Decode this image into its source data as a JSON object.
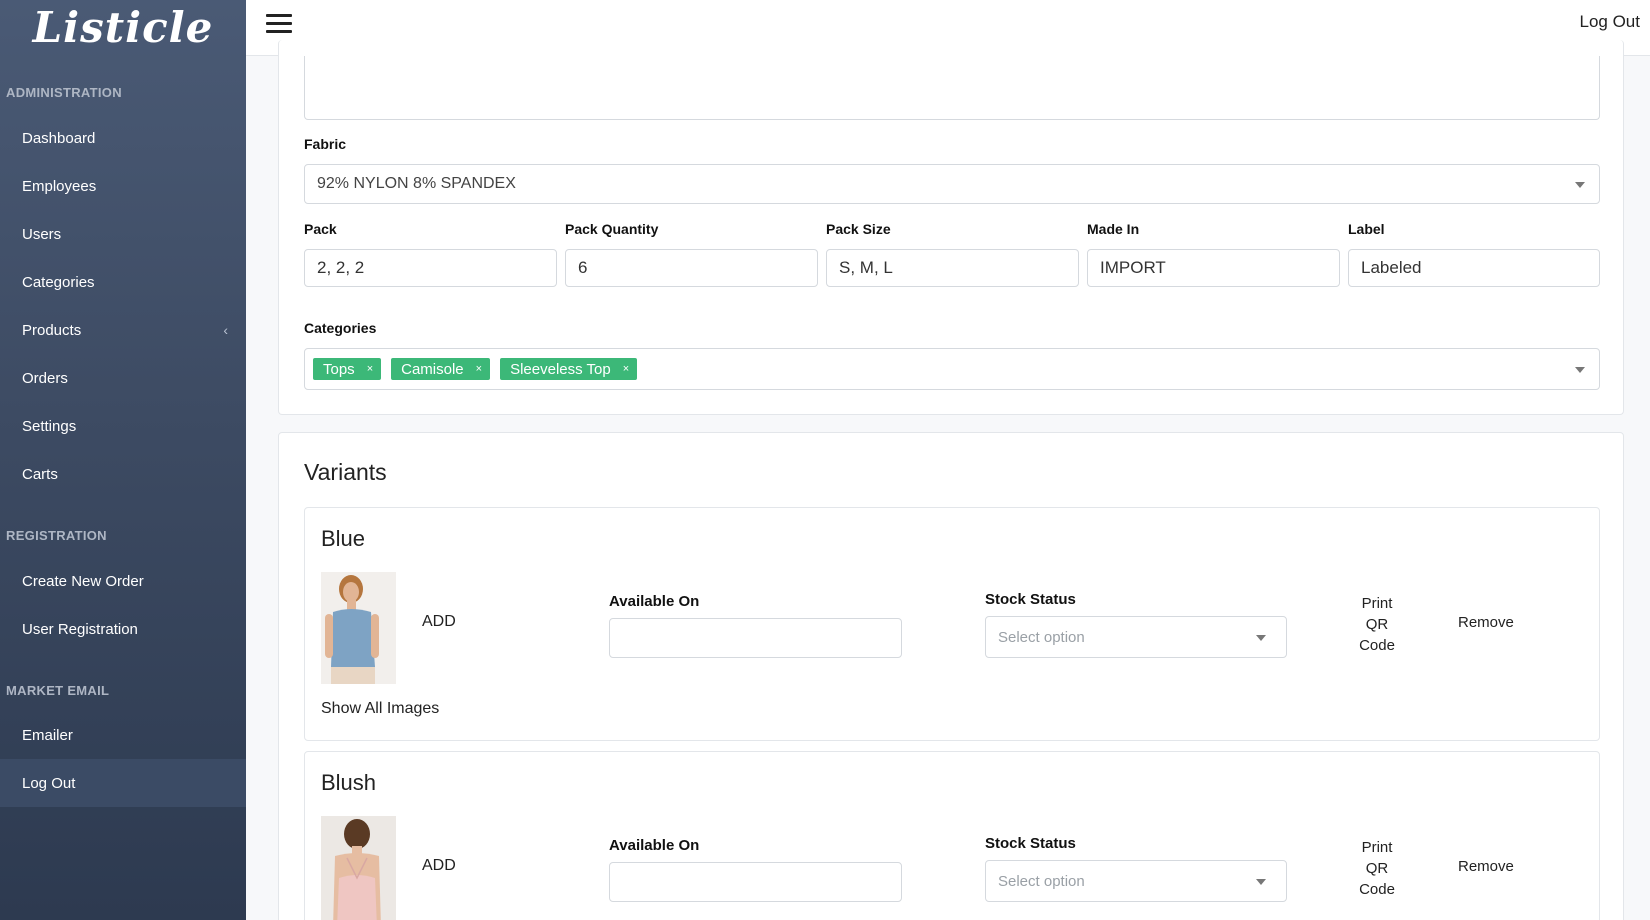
{
  "sidebar": {
    "brand": "Listicle",
    "sections": {
      "administration": "ADMINISTRATION",
      "registration": "REGISTRATION",
      "market_email": "MARKET EMAIL"
    },
    "items": {
      "dashboard": "Dashboard",
      "employees": "Employees",
      "users": "Users",
      "categories": "Categories",
      "products": "Products",
      "orders": "Orders",
      "settings": "Settings",
      "carts": "Carts",
      "create_order": "Create New Order",
      "user_registration": "User Registration",
      "emailer": "Emailer",
      "logout": "Log Out"
    },
    "products_chevron": "‹"
  },
  "topbar": {
    "logout": "Log Out"
  },
  "form": {
    "fabric_label": "Fabric",
    "fabric_value": "92% NYLON 8% SPANDEX",
    "pack_label": "Pack",
    "pack_value": "2, 2, 2",
    "pack_qty_label": "Pack Quantity",
    "pack_qty_value": "6",
    "pack_size_label": "Pack Size",
    "pack_size_value": "S, M, L",
    "made_in_label": "Made In",
    "made_in_value": "IMPORT",
    "label_label": "Label",
    "label_value": "Labeled",
    "categories_label": "Categories",
    "categories": [
      "Tops",
      "Camisole",
      "Sleeveless Top"
    ],
    "remove_symbol": "×"
  },
  "variants": {
    "heading": "Variants",
    "items": [
      {
        "name": "Blue",
        "add": "ADD",
        "available_label": "Available On",
        "stock_label": "Stock Status",
        "stock_placeholder": "Select option",
        "print_qr": [
          "Print",
          "QR",
          "Code"
        ],
        "remove": "Remove",
        "show_all": "Show All Images",
        "top_color": "#7ea3c4",
        "skin_color": "#e2b595"
      },
      {
        "name": "Blush",
        "add": "ADD",
        "available_label": "Available On",
        "stock_label": "Stock Status",
        "stock_placeholder": "Select option",
        "print_qr": [
          "Print",
          "QR",
          "Code"
        ],
        "remove": "Remove",
        "top_color": "#efc6c2",
        "skin_color": "#e6bda2"
      }
    ]
  },
  "colors": {
    "tag": "#3cb878",
    "sidebar_top": "#4a5a75",
    "sidebar_bottom": "#2d3a50"
  }
}
